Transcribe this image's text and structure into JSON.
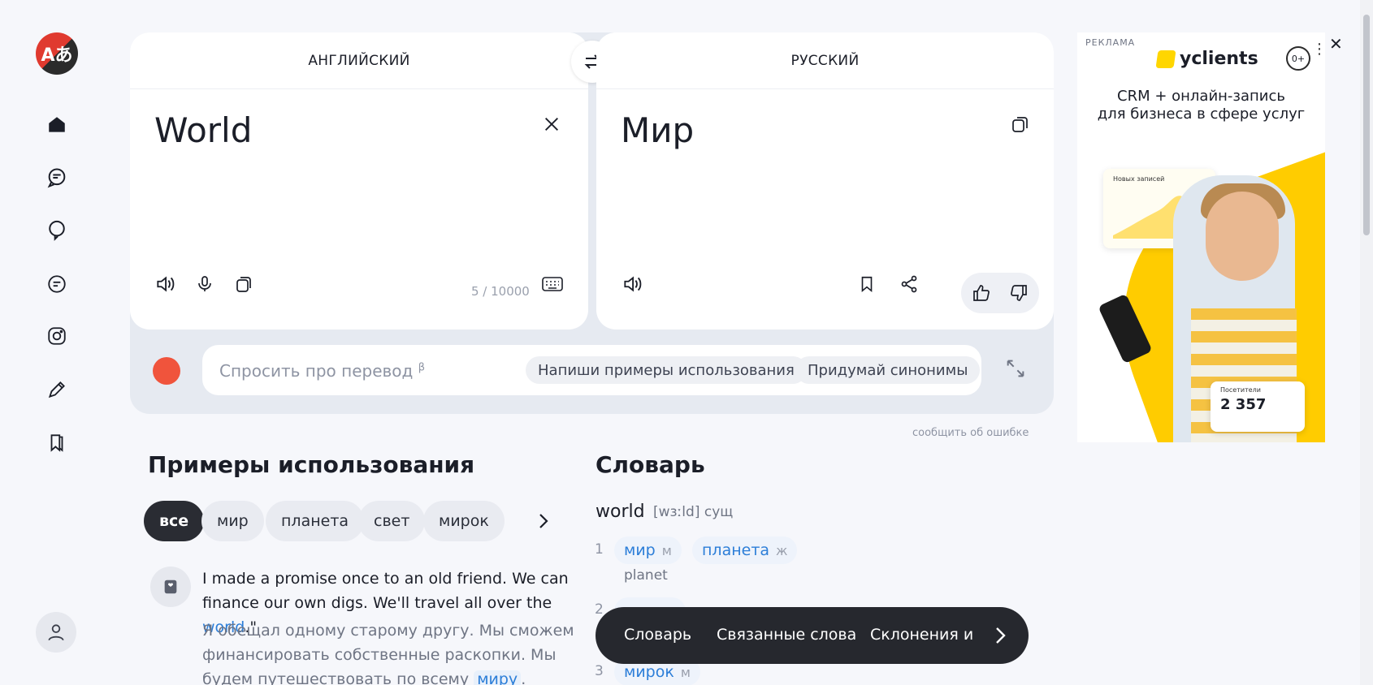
{
  "app": {
    "logo_text": "Aあ"
  },
  "sidebar": {
    "items": [
      {
        "name": "home",
        "icon": "home-icon"
      },
      {
        "name": "chat",
        "icon": "chat-icon"
      },
      {
        "name": "bubble",
        "icon": "speech-bubble-icon"
      },
      {
        "name": "documents",
        "icon": "document-icon"
      },
      {
        "name": "camera",
        "icon": "camera-icon"
      },
      {
        "name": "edit",
        "icon": "pencil-icon"
      },
      {
        "name": "bookmarks",
        "icon": "bookmarks-icon"
      }
    ],
    "profile_icon": "user-icon"
  },
  "translator": {
    "source_lang": "АНГЛИЙСКИЙ",
    "target_lang": "РУССКИЙ",
    "source_text": "World",
    "target_text": "Мир",
    "char_counter": "5 / 10000"
  },
  "ask": {
    "placeholder": "Спросить про перевод",
    "beta_mark": "β",
    "chips": [
      "Напиши примеры использования",
      "Придумай синонимы"
    ]
  },
  "report_error": "сообщить об ошибке",
  "examples": {
    "title": "Примеры использования",
    "filters": [
      "все",
      "мир",
      "планета",
      "свет",
      "мирок"
    ],
    "active_filter": "все",
    "item": {
      "en_before": "I made a promise once to an old friend. We can finance our own digs. We'll travel all over the ",
      "en_highlight": "world",
      "en_after": ".\"",
      "ru_before": "Я обещал одному старому другу. Мы сможем финансировать собственные раскопки. Мы будем путешествовать по всему ",
      "ru_highlight": "миру",
      "ru_after": "."
    }
  },
  "dictionary": {
    "title": "Словарь",
    "word": "world",
    "transcription": "[wɜːld] сущ",
    "senses": [
      {
        "num": "1",
        "items": [
          {
            "word": "мир",
            "gender": "м"
          },
          {
            "word": "планета",
            "gender": "ж"
          }
        ],
        "synonym": "planet"
      },
      {
        "num": "2"
      },
      {
        "num": "3",
        "items": [
          {
            "word": "мирок",
            "gender": "м"
          }
        ]
      }
    ]
  },
  "bottom_nav": {
    "items": [
      "Словарь",
      "Связанные слова",
      "Склонения и с"
    ]
  },
  "ad": {
    "label": "РЕКЛАМА",
    "brand": "yclients",
    "age_rating": "0+",
    "headline_1": "CRM + онлайн-запись",
    "headline_2": "для бизнеса в сфере услуг",
    "card_title": "Новых записей",
    "stat_label": "Посетители",
    "stat_value": "2 357",
    "colors": {
      "accent": "#ffcc00"
    }
  },
  "colors": {
    "link": "#2c7ed8",
    "alice": "#f0543c",
    "dark": "#26282e"
  }
}
